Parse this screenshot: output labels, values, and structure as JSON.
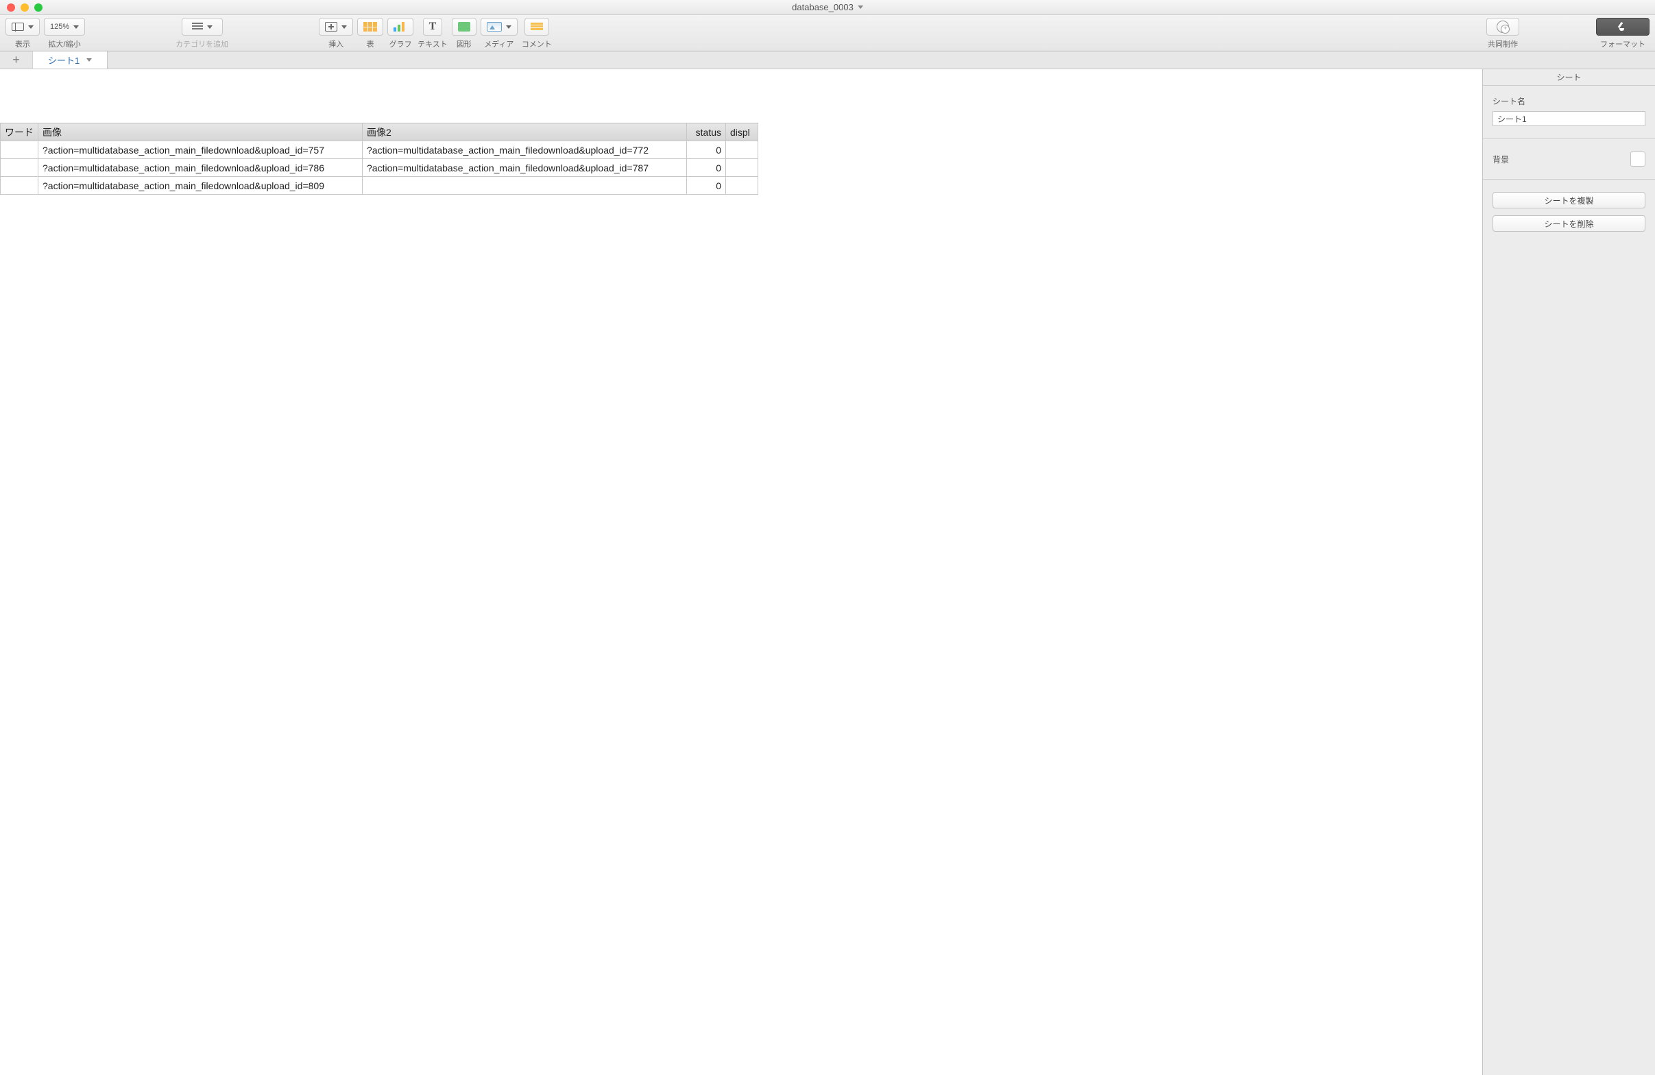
{
  "window": {
    "title": "database_0003"
  },
  "toolbar": {
    "view_label": "表示",
    "zoom_value": "125%",
    "zoom_label": "拡大/縮小",
    "category_placeholder": "カテゴリを追加",
    "insert_label": "挿入",
    "table_label": "表",
    "chart_label": "グラフ",
    "text_label": "テキスト",
    "shape_label": "図形",
    "media_label": "メディア",
    "comment_label": "コメント",
    "share_label": "共同制作",
    "format_label": "フォーマット"
  },
  "tabs": {
    "sheet1": "シート1"
  },
  "table": {
    "headers": [
      "ワード",
      "画像",
      "画像2",
      "status",
      "displ"
    ],
    "rows": [
      {
        "c0": "",
        "c1": "?action=multidatabase_action_main_filedownload&upload_id=757",
        "c2": "?action=multidatabase_action_main_filedownload&upload_id=772",
        "c3": "0",
        "c4": ""
      },
      {
        "c0": "",
        "c1": "?action=multidatabase_action_main_filedownload&upload_id=786",
        "c2": "?action=multidatabase_action_main_filedownload&upload_id=787",
        "c3": "0",
        "c4": ""
      },
      {
        "c0": "",
        "c1": "?action=multidatabase_action_main_filedownload&upload_id=809",
        "c2": "",
        "c3": "0",
        "c4": ""
      }
    ]
  },
  "inspector": {
    "tab_label": "シート",
    "name_label": "シート名",
    "name_value": "シート1",
    "background_label": "背景",
    "duplicate_label": "シートを複製",
    "delete_label": "シートを削除"
  }
}
